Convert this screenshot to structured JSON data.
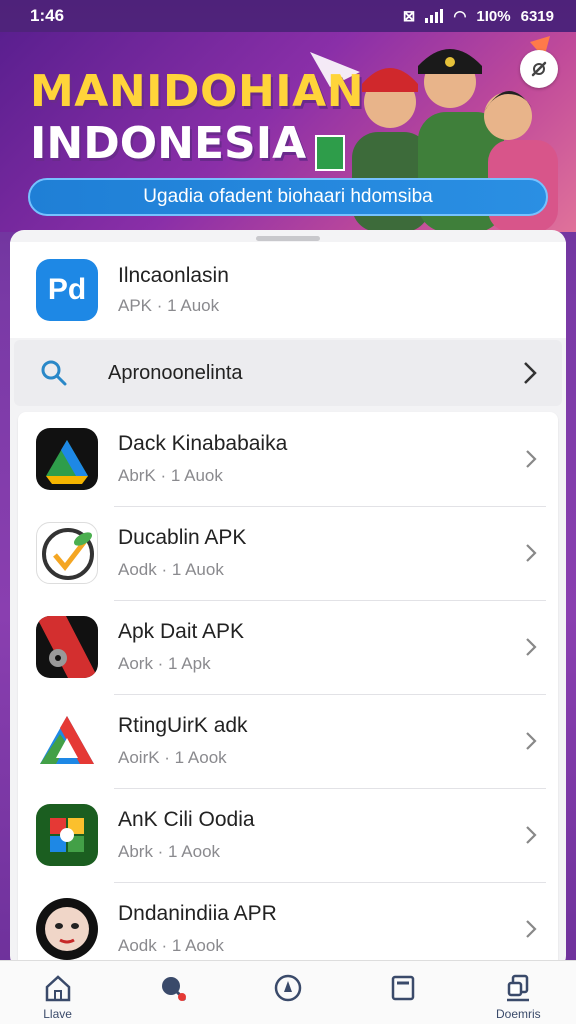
{
  "status_bar": {
    "time": "1:46",
    "battery": "6319",
    "signal_text": "1I0%"
  },
  "banner": {
    "title_line1": "MANIDOHIAN",
    "title_line2": "INDONESIA",
    "pill_text": "Ugadia ofadent biohaari hdomsiba"
  },
  "top_app": {
    "name": "Ilncaonlasin",
    "sub": "APK · 1 Auok",
    "icon_text": "Pd"
  },
  "search": {
    "label": "Apronoonelinta"
  },
  "apps": [
    {
      "name": "Dack Kinababaika",
      "sub": "AbrK · 1 Auok",
      "icon": "drive-like-icon"
    },
    {
      "name": "Ducablin APK",
      "sub": "Aodk · 1 Auok",
      "icon": "leaf-check-icon"
    },
    {
      "name": "Apk Dait APK",
      "sub": "Aork · 1 Apk",
      "icon": "record-icon"
    },
    {
      "name": "RtingUirK adk",
      "sub": "AoirK · 1 Aook",
      "icon": "triangle-logo-icon"
    },
    {
      "name": "AnK Cili Oodia",
      "sub": "Abrk · 1 Aook",
      "icon": "puzzle-logo-icon"
    },
    {
      "name": "Dndanindiia APR",
      "sub": "Aodk · 1 Aook",
      "icon": "mask-logo-icon"
    }
  ],
  "nav": [
    {
      "label": "Llave",
      "icon": "home-icon"
    },
    {
      "label": "",
      "icon": "tag-icon"
    },
    {
      "label": "",
      "icon": "compass-icon"
    },
    {
      "label": "",
      "icon": "card-icon"
    },
    {
      "label": "Doemris",
      "icon": "downloads-icon"
    }
  ],
  "colors": {
    "accent": "#1e88e5",
    "banner_yellow": "#ffd43a",
    "sheet_bg": "#f3f3f5"
  }
}
